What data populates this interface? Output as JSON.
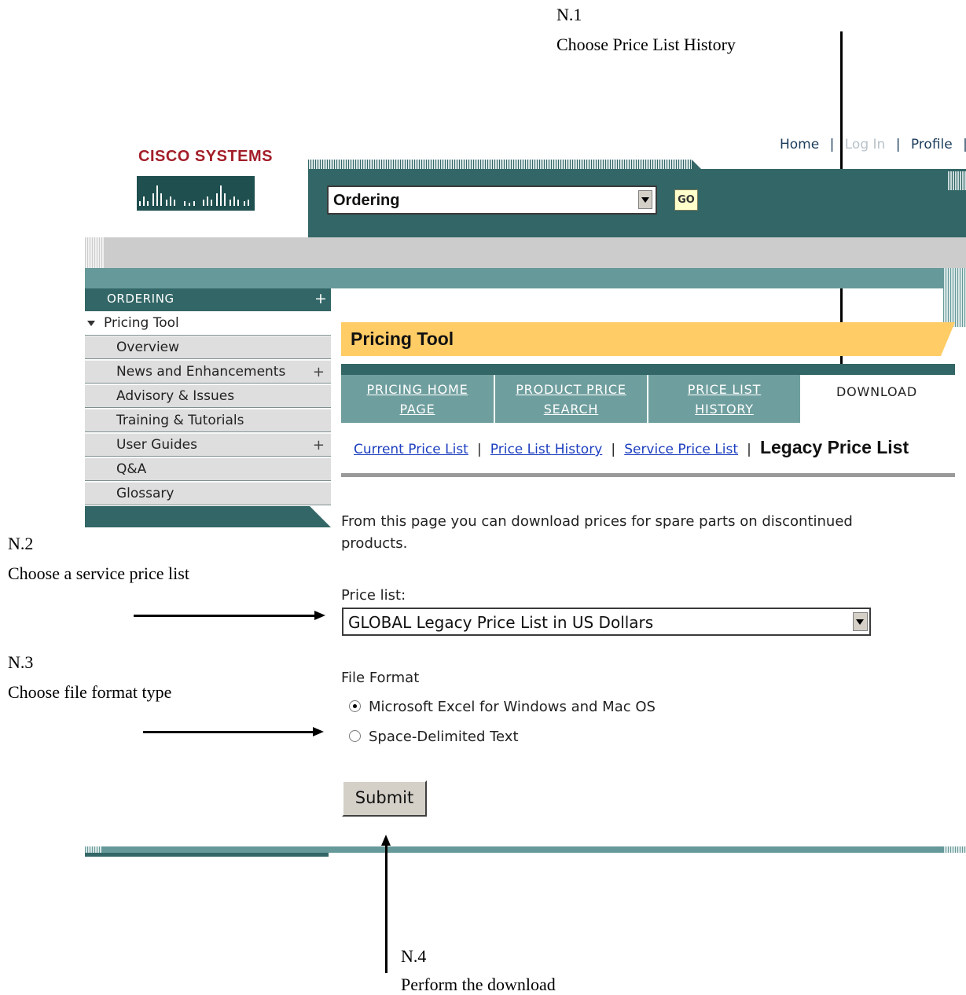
{
  "annotations": {
    "n1": {
      "id": "N.1",
      "text": "Choose Price List History"
    },
    "n2": {
      "id": "N.2",
      "text": "Choose a service price list"
    },
    "n3": {
      "id": "N.3",
      "text": "Choose file format type"
    },
    "n4": {
      "id": "N.4",
      "text": "Perform the download"
    }
  },
  "header": {
    "logo_text": "CISCO SYSTEMS",
    "links": {
      "home": "Home",
      "login": "Log In",
      "profile": "Profile",
      "sep": "|"
    },
    "nav_select": {
      "value": "Ordering"
    },
    "go_label": "GO"
  },
  "sidebar": {
    "section_label": "ORDERING",
    "section_plus": "+",
    "current": "Pricing Tool",
    "items": [
      {
        "label": "Overview",
        "plus": ""
      },
      {
        "label": "News and Enhancements",
        "plus": "+"
      },
      {
        "label": "Advisory & Issues",
        "plus": ""
      },
      {
        "label": "Training & Tutorials",
        "plus": ""
      },
      {
        "label": "User Guides",
        "plus": "+"
      },
      {
        "label": "Q&A",
        "plus": ""
      },
      {
        "label": "Glossary",
        "plus": ""
      }
    ]
  },
  "main": {
    "section_title": "ORDERING",
    "tool_title": "Pricing Tool",
    "tabs": [
      {
        "line1": "PRICING HOME",
        "line2": "PAGE"
      },
      {
        "line1": "PRODUCT PRICE",
        "line2": "SEARCH"
      },
      {
        "line1": "PRICE LIST",
        "line2": "HISTORY"
      }
    ],
    "active_tab": "DOWNLOAD",
    "subnav": {
      "current_price_list": "Current Price List",
      "price_list_history": "Price List History",
      "service_price_list": "Service Price List",
      "legacy_price_list": "Legacy Price List",
      "sep": "|"
    },
    "intro_line1": "From this page you can download prices for spare parts on discontinued",
    "intro_line2": "products.",
    "price_list_label": "Price list:",
    "price_list_value": "GLOBAL Legacy Price List in US Dollars",
    "file_format_label": "File Format",
    "format_options": [
      "Microsoft Excel for Windows and Mac OS",
      "Space-Delimited Text"
    ],
    "selected_format": "Microsoft Excel for Windows and Mac OS",
    "submit_label": "Submit"
  },
  "colors": {
    "teal_dark": "#336666",
    "teal_mid": "#669999",
    "tab_teal": "#6f9e9e",
    "gray_band": "#cccccc",
    "yellow_bar": "#ffcc66",
    "cisco_red": "#a31f2a",
    "link_blue": "#1d3fbf"
  }
}
